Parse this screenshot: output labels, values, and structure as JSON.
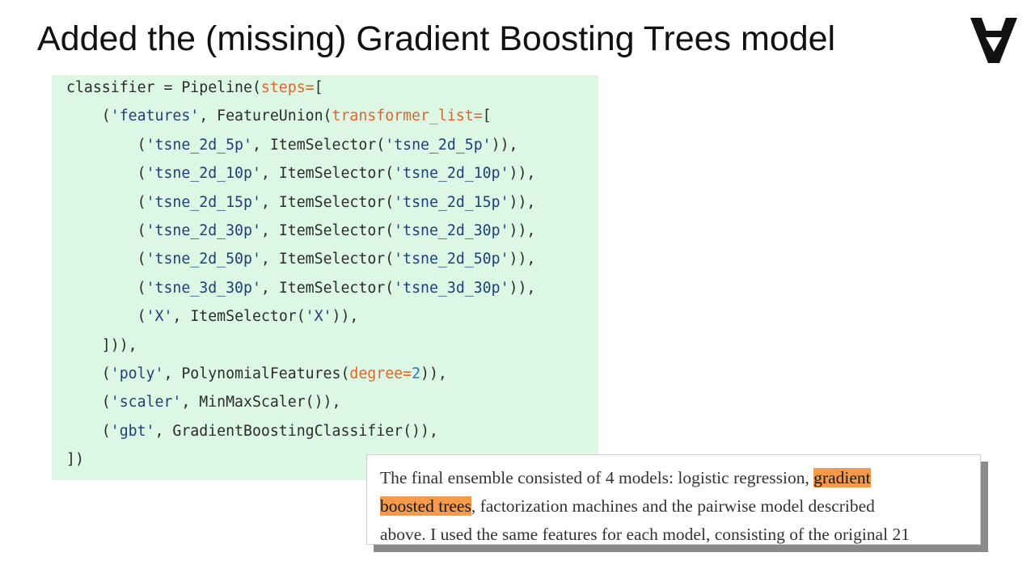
{
  "slide": {
    "title": "Added the (missing) Gradient Boosting Trees model",
    "logo_icon": "turned-a-logo-icon"
  },
  "code": {
    "lines": [
      [
        {
          "t": "classifier = Pipeline(",
          "c": "punc"
        },
        {
          "t": "steps=",
          "c": "kw"
        },
        {
          "t": "[",
          "c": "punc"
        }
      ],
      [
        {
          "t": "    (",
          "c": "punc"
        },
        {
          "t": "'features'",
          "c": "str"
        },
        {
          "t": ", FeatureUnion(",
          "c": "punc"
        },
        {
          "t": "transformer_list=",
          "c": "kw"
        },
        {
          "t": "[",
          "c": "punc"
        }
      ],
      [
        {
          "t": "        (",
          "c": "punc"
        },
        {
          "t": "'tsne_2d_5p'",
          "c": "str"
        },
        {
          "t": ", ItemSelector(",
          "c": "punc"
        },
        {
          "t": "'tsne_2d_5p'",
          "c": "str"
        },
        {
          "t": ")),",
          "c": "punc"
        }
      ],
      [
        {
          "t": "        (",
          "c": "punc"
        },
        {
          "t": "'tsne_2d_10p'",
          "c": "str"
        },
        {
          "t": ", ItemSelector(",
          "c": "punc"
        },
        {
          "t": "'tsne_2d_10p'",
          "c": "str"
        },
        {
          "t": ")),",
          "c": "punc"
        }
      ],
      [
        {
          "t": "        (",
          "c": "punc"
        },
        {
          "t": "'tsne_2d_15p'",
          "c": "str"
        },
        {
          "t": ", ItemSelector(",
          "c": "punc"
        },
        {
          "t": "'tsne_2d_15p'",
          "c": "str"
        },
        {
          "t": ")),",
          "c": "punc"
        }
      ],
      [
        {
          "t": "        (",
          "c": "punc"
        },
        {
          "t": "'tsne_2d_30p'",
          "c": "str"
        },
        {
          "t": ", ItemSelector(",
          "c": "punc"
        },
        {
          "t": "'tsne_2d_30p'",
          "c": "str"
        },
        {
          "t": ")),",
          "c": "punc"
        }
      ],
      [
        {
          "t": "        (",
          "c": "punc"
        },
        {
          "t": "'tsne_2d_50p'",
          "c": "str"
        },
        {
          "t": ", ItemSelector(",
          "c": "punc"
        },
        {
          "t": "'tsne_2d_50p'",
          "c": "str"
        },
        {
          "t": ")),",
          "c": "punc"
        }
      ],
      [
        {
          "t": "        (",
          "c": "punc"
        },
        {
          "t": "'tsne_3d_30p'",
          "c": "str"
        },
        {
          "t": ", ItemSelector(",
          "c": "punc"
        },
        {
          "t": "'tsne_3d_30p'",
          "c": "str"
        },
        {
          "t": ")),",
          "c": "punc"
        }
      ],
      [
        {
          "t": "        (",
          "c": "punc"
        },
        {
          "t": "'X'",
          "c": "str"
        },
        {
          "t": ", ItemSelector(",
          "c": "punc"
        },
        {
          "t": "'X'",
          "c": "str"
        },
        {
          "t": ")),",
          "c": "punc"
        }
      ],
      [
        {
          "t": "    ])),",
          "c": "punc"
        }
      ],
      [
        {
          "t": "    (",
          "c": "punc"
        },
        {
          "t": "'poly'",
          "c": "str"
        },
        {
          "t": ", PolynomialFeatures(",
          "c": "punc"
        },
        {
          "t": "degree=",
          "c": "kw"
        },
        {
          "t": "2",
          "c": "num"
        },
        {
          "t": ")),",
          "c": "punc"
        }
      ],
      [
        {
          "t": "    (",
          "c": "punc"
        },
        {
          "t": "'scaler'",
          "c": "str"
        },
        {
          "t": ", MinMaxScaler()),",
          "c": "punc"
        }
      ],
      [
        {
          "t": "    (",
          "c": "punc"
        },
        {
          "t": "'gbt'",
          "c": "str"
        },
        {
          "t": ", GradientBoostingClassifier()),",
          "c": "punc"
        }
      ],
      [
        {
          "t": "])",
          "c": "punc"
        }
      ]
    ],
    "colors": {
      "background": "#dcf8e4",
      "string": "#1f3f7a",
      "keyword_arg": "#e0652b",
      "number": "#2877c9",
      "text": "#2b2b2b"
    }
  },
  "quote": {
    "line1_pre": "The final ensemble consisted of 4 models: logistic regression, ",
    "line1_hl": "gradient",
    "line2_hl": "boosted trees",
    "line2_post": ", factorization machines and the pairwise model described",
    "line3": "above. I used the same features for each model, consisting of the original 21",
    "highlight_color": "#f59a4a"
  }
}
